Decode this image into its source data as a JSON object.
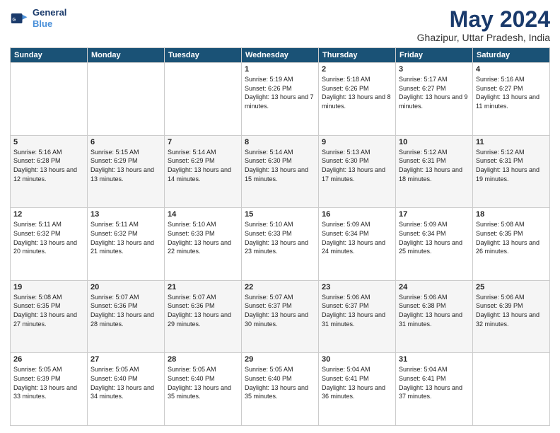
{
  "logo": {
    "line1": "General",
    "line2": "Blue"
  },
  "title": "May 2024",
  "subtitle": "Ghazipur, Uttar Pradesh, India",
  "headers": [
    "Sunday",
    "Monday",
    "Tuesday",
    "Wednesday",
    "Thursday",
    "Friday",
    "Saturday"
  ],
  "weeks": [
    [
      {
        "day": "",
        "sunrise": "",
        "sunset": "",
        "daylight": ""
      },
      {
        "day": "",
        "sunrise": "",
        "sunset": "",
        "daylight": ""
      },
      {
        "day": "",
        "sunrise": "",
        "sunset": "",
        "daylight": ""
      },
      {
        "day": "1",
        "sunrise": "Sunrise: 5:19 AM",
        "sunset": "Sunset: 6:26 PM",
        "daylight": "Daylight: 13 hours and 7 minutes."
      },
      {
        "day": "2",
        "sunrise": "Sunrise: 5:18 AM",
        "sunset": "Sunset: 6:26 PM",
        "daylight": "Daylight: 13 hours and 8 minutes."
      },
      {
        "day": "3",
        "sunrise": "Sunrise: 5:17 AM",
        "sunset": "Sunset: 6:27 PM",
        "daylight": "Daylight: 13 hours and 9 minutes."
      },
      {
        "day": "4",
        "sunrise": "Sunrise: 5:16 AM",
        "sunset": "Sunset: 6:27 PM",
        "daylight": "Daylight: 13 hours and 11 minutes."
      }
    ],
    [
      {
        "day": "5",
        "sunrise": "Sunrise: 5:16 AM",
        "sunset": "Sunset: 6:28 PM",
        "daylight": "Daylight: 13 hours and 12 minutes."
      },
      {
        "day": "6",
        "sunrise": "Sunrise: 5:15 AM",
        "sunset": "Sunset: 6:29 PM",
        "daylight": "Daylight: 13 hours and 13 minutes."
      },
      {
        "day": "7",
        "sunrise": "Sunrise: 5:14 AM",
        "sunset": "Sunset: 6:29 PM",
        "daylight": "Daylight: 13 hours and 14 minutes."
      },
      {
        "day": "8",
        "sunrise": "Sunrise: 5:14 AM",
        "sunset": "Sunset: 6:30 PM",
        "daylight": "Daylight: 13 hours and 15 minutes."
      },
      {
        "day": "9",
        "sunrise": "Sunrise: 5:13 AM",
        "sunset": "Sunset: 6:30 PM",
        "daylight": "Daylight: 13 hours and 17 minutes."
      },
      {
        "day": "10",
        "sunrise": "Sunrise: 5:12 AM",
        "sunset": "Sunset: 6:31 PM",
        "daylight": "Daylight: 13 hours and 18 minutes."
      },
      {
        "day": "11",
        "sunrise": "Sunrise: 5:12 AM",
        "sunset": "Sunset: 6:31 PM",
        "daylight": "Daylight: 13 hours and 19 minutes."
      }
    ],
    [
      {
        "day": "12",
        "sunrise": "Sunrise: 5:11 AM",
        "sunset": "Sunset: 6:32 PM",
        "daylight": "Daylight: 13 hours and 20 minutes."
      },
      {
        "day": "13",
        "sunrise": "Sunrise: 5:11 AM",
        "sunset": "Sunset: 6:32 PM",
        "daylight": "Daylight: 13 hours and 21 minutes."
      },
      {
        "day": "14",
        "sunrise": "Sunrise: 5:10 AM",
        "sunset": "Sunset: 6:33 PM",
        "daylight": "Daylight: 13 hours and 22 minutes."
      },
      {
        "day": "15",
        "sunrise": "Sunrise: 5:10 AM",
        "sunset": "Sunset: 6:33 PM",
        "daylight": "Daylight: 13 hours and 23 minutes."
      },
      {
        "day": "16",
        "sunrise": "Sunrise: 5:09 AM",
        "sunset": "Sunset: 6:34 PM",
        "daylight": "Daylight: 13 hours and 24 minutes."
      },
      {
        "day": "17",
        "sunrise": "Sunrise: 5:09 AM",
        "sunset": "Sunset: 6:34 PM",
        "daylight": "Daylight: 13 hours and 25 minutes."
      },
      {
        "day": "18",
        "sunrise": "Sunrise: 5:08 AM",
        "sunset": "Sunset: 6:35 PM",
        "daylight": "Daylight: 13 hours and 26 minutes."
      }
    ],
    [
      {
        "day": "19",
        "sunrise": "Sunrise: 5:08 AM",
        "sunset": "Sunset: 6:35 PM",
        "daylight": "Daylight: 13 hours and 27 minutes."
      },
      {
        "day": "20",
        "sunrise": "Sunrise: 5:07 AM",
        "sunset": "Sunset: 6:36 PM",
        "daylight": "Daylight: 13 hours and 28 minutes."
      },
      {
        "day": "21",
        "sunrise": "Sunrise: 5:07 AM",
        "sunset": "Sunset: 6:36 PM",
        "daylight": "Daylight: 13 hours and 29 minutes."
      },
      {
        "day": "22",
        "sunrise": "Sunrise: 5:07 AM",
        "sunset": "Sunset: 6:37 PM",
        "daylight": "Daylight: 13 hours and 30 minutes."
      },
      {
        "day": "23",
        "sunrise": "Sunrise: 5:06 AM",
        "sunset": "Sunset: 6:37 PM",
        "daylight": "Daylight: 13 hours and 31 minutes."
      },
      {
        "day": "24",
        "sunrise": "Sunrise: 5:06 AM",
        "sunset": "Sunset: 6:38 PM",
        "daylight": "Daylight: 13 hours and 31 minutes."
      },
      {
        "day": "25",
        "sunrise": "Sunrise: 5:06 AM",
        "sunset": "Sunset: 6:39 PM",
        "daylight": "Daylight: 13 hours and 32 minutes."
      }
    ],
    [
      {
        "day": "26",
        "sunrise": "Sunrise: 5:05 AM",
        "sunset": "Sunset: 6:39 PM",
        "daylight": "Daylight: 13 hours and 33 minutes."
      },
      {
        "day": "27",
        "sunrise": "Sunrise: 5:05 AM",
        "sunset": "Sunset: 6:40 PM",
        "daylight": "Daylight: 13 hours and 34 minutes."
      },
      {
        "day": "28",
        "sunrise": "Sunrise: 5:05 AM",
        "sunset": "Sunset: 6:40 PM",
        "daylight": "Daylight: 13 hours and 35 minutes."
      },
      {
        "day": "29",
        "sunrise": "Sunrise: 5:05 AM",
        "sunset": "Sunset: 6:40 PM",
        "daylight": "Daylight: 13 hours and 35 minutes."
      },
      {
        "day": "30",
        "sunrise": "Sunrise: 5:04 AM",
        "sunset": "Sunset: 6:41 PM",
        "daylight": "Daylight: 13 hours and 36 minutes."
      },
      {
        "day": "31",
        "sunrise": "Sunrise: 5:04 AM",
        "sunset": "Sunset: 6:41 PM",
        "daylight": "Daylight: 13 hours and 37 minutes."
      },
      {
        "day": "",
        "sunrise": "",
        "sunset": "",
        "daylight": ""
      }
    ]
  ]
}
